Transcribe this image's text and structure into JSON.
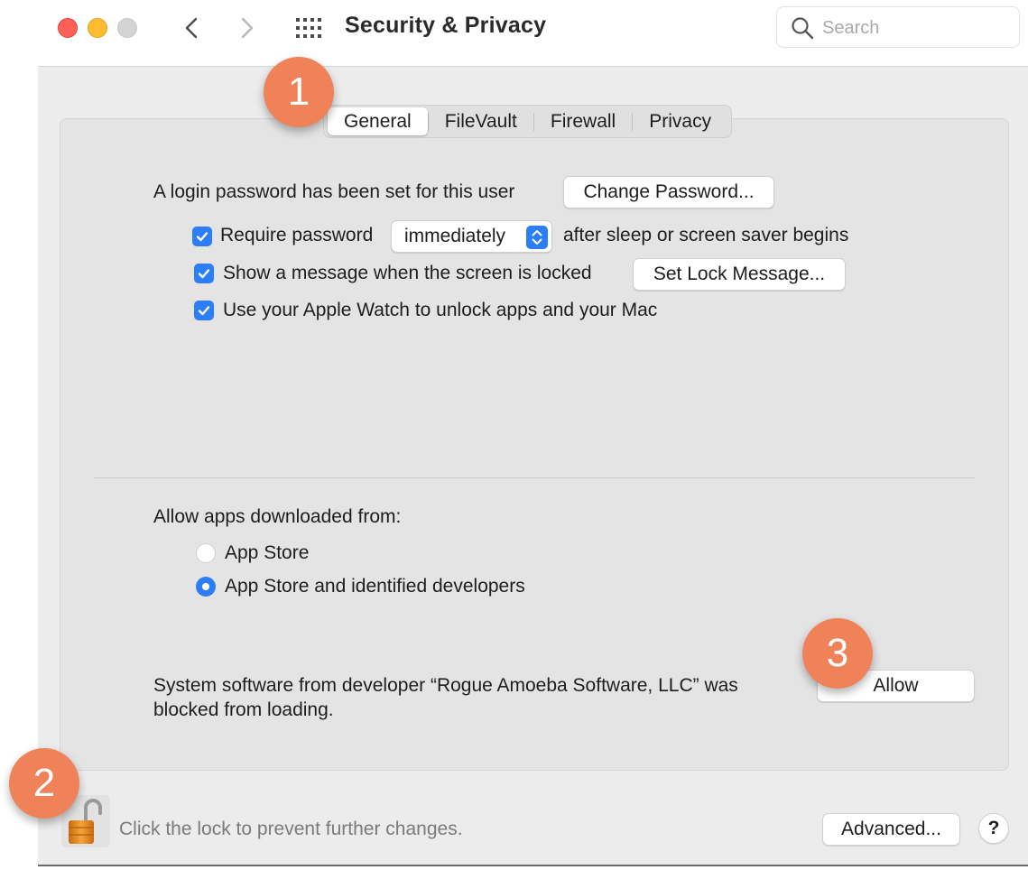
{
  "window": {
    "title": "Security & Privacy",
    "search_placeholder": "Search"
  },
  "tabs": [
    {
      "label": "General",
      "active": true
    },
    {
      "label": "FileVault",
      "active": false
    },
    {
      "label": "Firewall",
      "active": false
    },
    {
      "label": "Privacy",
      "active": false
    }
  ],
  "general": {
    "login_password_text": "A login password has been set for this user",
    "change_password_label": "Change Password...",
    "require_password": {
      "checked": true,
      "label": "Require password",
      "delay_selected": "immediately",
      "suffix": "after sleep or screen saver begins"
    },
    "show_message": {
      "checked": true,
      "label": "Show a message when the screen is locked",
      "button_label": "Set Lock Message..."
    },
    "apple_watch": {
      "checked": true,
      "label": "Use your Apple Watch to unlock apps and your Mac"
    },
    "allow_apps": {
      "heading": "Allow apps downloaded from:",
      "options": [
        {
          "label": "App Store",
          "selected": false
        },
        {
          "label": "App Store and identified developers",
          "selected": true
        }
      ]
    },
    "blocked": {
      "line1": "System software from developer “Rogue Amoeba Software, LLC” was",
      "line2": "blocked from loading.",
      "allow_label": "Allow"
    }
  },
  "footer": {
    "lock_caption": "Click the lock to prevent further changes.",
    "advanced_label": "Advanced...",
    "help_label": "?"
  },
  "callouts": [
    "1",
    "2",
    "3"
  ],
  "colors": {
    "accent": "#2b7ef6",
    "callout": "#f0825a",
    "close": "#fe5f57",
    "minimize": "#febc2e"
  }
}
